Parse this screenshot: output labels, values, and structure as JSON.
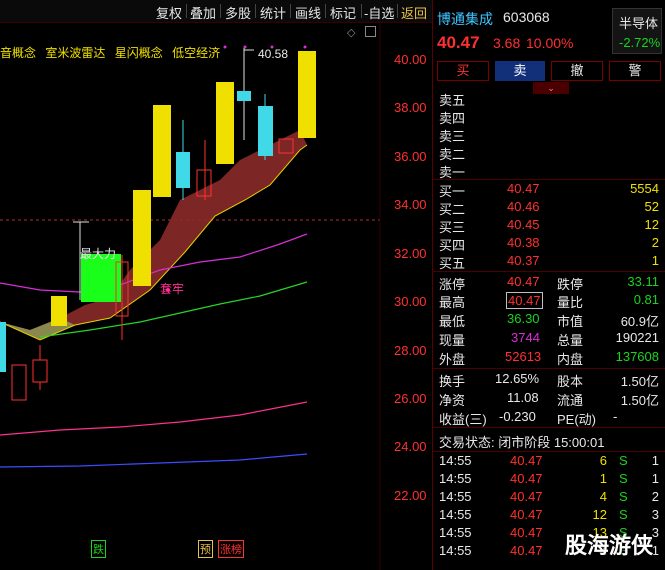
{
  "toolbar": {
    "items": [
      "复权",
      "叠加",
      "多股",
      "统计",
      "画线",
      "标记",
      "-自选",
      "返回"
    ]
  },
  "chart": {
    "concepts": [
      "音概念",
      "室米波雷达",
      "星闪概念",
      "低空经济"
    ],
    "y_ticks": [
      "40.00",
      "38.00",
      "36.00",
      "34.00",
      "32.00",
      "30.00",
      "28.00",
      "26.00",
      "24.00",
      "22.00"
    ],
    "max_label": "40.58",
    "anno_mid": "最大力",
    "anno_low": "套牢",
    "bottom_marks": [
      "跌",
      "预",
      "涨榜"
    ]
  },
  "stock": {
    "name": "博通集成",
    "code": "603068",
    "price": "40.47",
    "change": "3.68",
    "pct": "10.00%",
    "sector": "半导体",
    "sector_pct": "-2.72%"
  },
  "buttons": [
    "买",
    "卖",
    "撤",
    "警"
  ],
  "sell_orders": [
    {
      "label": "卖五"
    },
    {
      "label": "卖四"
    },
    {
      "label": "卖三"
    },
    {
      "label": "卖二"
    },
    {
      "label": "卖一"
    }
  ],
  "buy_orders": [
    {
      "label": "买一",
      "price": "40.47",
      "vol": "5554"
    },
    {
      "label": "买二",
      "price": "40.46",
      "vol": "52"
    },
    {
      "label": "买三",
      "price": "40.45",
      "vol": "12"
    },
    {
      "label": "买四",
      "price": "40.38",
      "vol": "2"
    },
    {
      "label": "买五",
      "price": "40.37",
      "vol": "1"
    }
  ],
  "stats": [
    {
      "k1": "涨停",
      "v1": "40.47",
      "k2": "跌停",
      "v2": "33.11"
    },
    {
      "k1": "最高",
      "v1": "40.47",
      "k2": "量比",
      "v2": "0.81"
    },
    {
      "k1": "最低",
      "v1": "36.30",
      "k2": "市值",
      "v2": "60.9亿"
    },
    {
      "k1": "现量",
      "v1": "3744",
      "k2": "总量",
      "v2": "190221"
    },
    {
      "k1": "外盘",
      "v1": "52613",
      "k2": "内盘",
      "v2": "137608"
    }
  ],
  "stats2": [
    {
      "k1": "换手",
      "v1": "12.65%",
      "k2": "股本",
      "v2": "1.50亿"
    },
    {
      "k1": "净资",
      "v1": "11.08",
      "k2": "流通",
      "v2": "1.50亿"
    },
    {
      "k1": "收益(三)",
      "v1": "-0.230",
      "k2": "PE(动)",
      "v2": "-"
    }
  ],
  "trade_status": "交易状态: 闭市阶段 15:00:01",
  "ticks": [
    {
      "time": "14:55",
      "price": "40.47",
      "vol": "6",
      "side": "S",
      "n": "1"
    },
    {
      "time": "14:55",
      "price": "40.47",
      "vol": "1",
      "side": "S",
      "n": "1"
    },
    {
      "time": "14:55",
      "price": "40.47",
      "vol": "4",
      "side": "S",
      "n": "2"
    },
    {
      "time": "14:55",
      "price": "40.47",
      "vol": "12",
      "side": "S",
      "n": "3"
    },
    {
      "time": "14:55",
      "price": "40.47",
      "vol": "13",
      "side": "S",
      "n": "3"
    },
    {
      "time": "14:55",
      "price": "40.47",
      "vol": "1",
      "side": "S",
      "n": "1"
    }
  ],
  "watermark": "股海游侠",
  "colors": {
    "up": "#ff3030",
    "down": "#19d41e",
    "accent": "#f0e000"
  }
}
